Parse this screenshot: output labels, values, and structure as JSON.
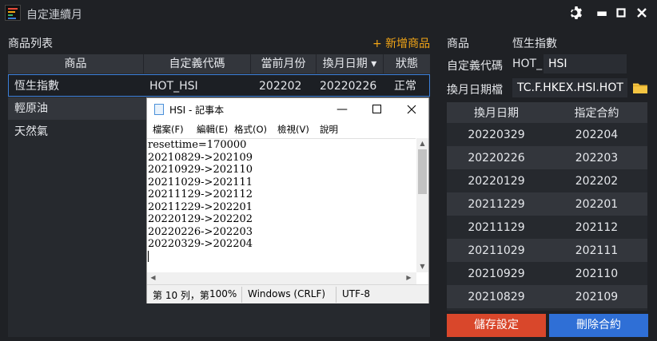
{
  "window": {
    "title": "自定連續月",
    "icons": [
      "gear-icon",
      "minimize-icon",
      "maximize-icon",
      "close-icon"
    ]
  },
  "left": {
    "header": "商品列表",
    "add_label": "+ 新增商品",
    "columns": [
      "商品",
      "自定義代碼",
      "當前月份",
      "換月日期 ▾",
      "狀態"
    ],
    "rows": [
      {
        "name": "恆生指數",
        "code": "HOT_HSI",
        "month": "202202",
        "date": "20220226",
        "status": "正常"
      },
      {
        "name": "輕原油",
        "code": "",
        "month": "",
        "date": "",
        "status": ""
      },
      {
        "name": "天然氣",
        "code": "",
        "month": "",
        "date": "",
        "status": ""
      }
    ]
  },
  "notepad": {
    "title": "HSI - 記事本",
    "menu": [
      "檔案(F)",
      "編輯(E)",
      "格式(O)",
      "檢視(V)",
      "說明"
    ],
    "lines": [
      "resettime=170000",
      "20210829->202109",
      "20210929->202110",
      "20211029->202111",
      "20211129->202112",
      "20211229->202201",
      "20220129->202202",
      "20220226->202203",
      "20220329->202204"
    ],
    "status": {
      "position": "第 10 列，第",
      "zoom": "100%",
      "eol": "Windows (CRLF)",
      "encoding": "UTF-8"
    }
  },
  "right": {
    "product_label": "商品",
    "product_value": "恆生指數",
    "code_label": "自定義代碼",
    "code_prefix": "HOT_",
    "code_value": "HSI",
    "file_label": "換月日期檔",
    "file_value": "TC.F.HKEX.HSI.HOT",
    "columns": [
      "換月日期",
      "指定合約"
    ],
    "rows": [
      [
        "20220329",
        "202204"
      ],
      [
        "20220226",
        "202203"
      ],
      [
        "20220129",
        "202202"
      ],
      [
        "20211229",
        "202201"
      ],
      [
        "20211129",
        "202112"
      ],
      [
        "20211029",
        "202111"
      ],
      [
        "20210929",
        "202110"
      ],
      [
        "20210829",
        "202109"
      ]
    ],
    "save_label": "儲存設定",
    "delete_label": "刪除合約"
  },
  "colors": {
    "background": "#1f2125",
    "accent_orange": "#f2a516",
    "selection_blue": "#3b7fd9",
    "save_red": "#d9472b",
    "delete_blue": "#2f6fd6",
    "folder_yellow": "#f5c542"
  }
}
